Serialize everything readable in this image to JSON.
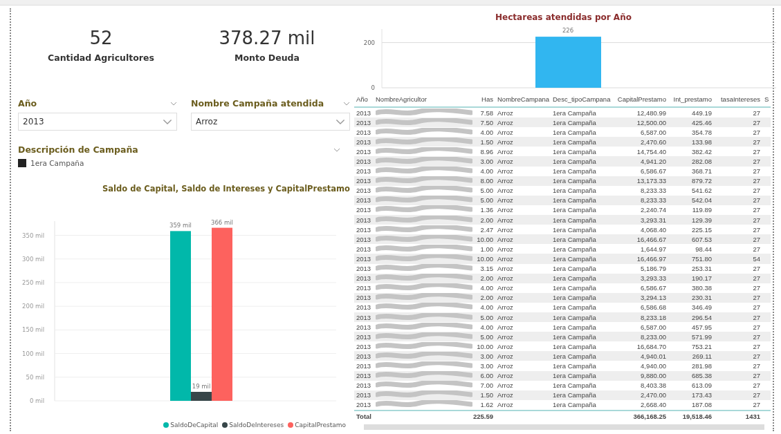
{
  "kpis": [
    {
      "value": "52",
      "label": "Cantidad Agricultores"
    },
    {
      "value": "378.27 mil",
      "label": "Monto Deuda"
    }
  ],
  "slicers": [
    {
      "title": "Año",
      "value": "2013"
    },
    {
      "title": "Nombre Campaña atendida",
      "value": "Arroz"
    }
  ],
  "description_slicer": {
    "title": "Descripción de Campaña",
    "items": [
      {
        "label": "1era Campaña",
        "checked": true
      }
    ]
  },
  "capital_chart": {
    "chart_data": {
      "type": "bar",
      "title": "Saldo de Capital, Saldo de Intereses y CapitalPrestamo",
      "grid": true,
      "series": [
        {
          "name": "SaldoDeCapital",
          "color": "#01b8aa",
          "values": [
            359
          ]
        },
        {
          "name": "SaldoDeIntereses",
          "color": "#374649",
          "values": [
            19
          ]
        },
        {
          "name": "CapitalPrestamo",
          "color": "#fd625e",
          "values": [
            366
          ]
        }
      ],
      "ylim": [
        0,
        380
      ],
      "yticks": [
        {
          "value": 0,
          "label": "0 mil"
        },
        {
          "value": 50,
          "label": "50 mil"
        },
        {
          "value": 100,
          "label": "100 mil"
        },
        {
          "value": 150,
          "label": "150 mil"
        },
        {
          "value": 200,
          "label": "200 mil"
        },
        {
          "value": 250,
          "label": "250 mil"
        },
        {
          "value": 300,
          "label": "300 mil"
        },
        {
          "value": 350,
          "label": "350 mil"
        }
      ],
      "value_labels": [
        "359 mil",
        "19 mil",
        "366 mil"
      ]
    }
  },
  "hectares_chart": {
    "chart_data": {
      "type": "bar",
      "title": "Hectareas atendidas por Año",
      "grid": true,
      "series": [
        {
          "color": "#31b6f0",
          "values": [
            226
          ]
        }
      ],
      "ylim": [
        0,
        260
      ],
      "yticks": [
        0,
        200
      ],
      "value_labels": [
        "226"
      ]
    }
  },
  "table": {
    "columns": [
      "Año",
      "NombreAgricultor",
      "Has",
      "NombreCampana",
      "Desc_tipoCampana",
      "CapitalPrestamo",
      "Int_prestamo",
      "tasaIntereses",
      "S"
    ],
    "rows": [
      {
        "cells": [
          "2013",
          "",
          "7.58",
          "Arroz",
          "1era Campaña",
          "12,480.99",
          "449.19",
          "27"
        ]
      },
      {
        "cells": [
          "2013",
          "",
          "7.50",
          "Arroz",
          "1era Campaña",
          "12,500.00",
          "425.46",
          "27"
        ]
      },
      {
        "cells": [
          "2013",
          "",
          "4.00",
          "Arroz",
          "1era Campaña",
          "6,587.00",
          "354.78",
          "27"
        ]
      },
      {
        "cells": [
          "2013",
          "",
          "1.50",
          "Arroz",
          "1era Campaña",
          "2,470.60",
          "133.98",
          "27"
        ]
      },
      {
        "cells": [
          "2013",
          "",
          "8.96",
          "Arroz",
          "1era Campaña",
          "14,754.40",
          "382.42",
          "27"
        ]
      },
      {
        "cells": [
          "2013",
          "",
          "3.00",
          "Arroz",
          "1era Campaña",
          "4,941.20",
          "282.08",
          "27"
        ]
      },
      {
        "cells": [
          "2013",
          "",
          "4.00",
          "Arroz",
          "1era Campaña",
          "6,586.67",
          "368.71",
          "27"
        ]
      },
      {
        "cells": [
          "2013",
          "",
          "8.00",
          "Arroz",
          "1era Campaña",
          "13,173.33",
          "879.72",
          "27"
        ]
      },
      {
        "cells": [
          "2013",
          "",
          "5.00",
          "Arroz",
          "1era Campaña",
          "8,233.33",
          "541.62",
          "27"
        ]
      },
      {
        "cells": [
          "2013",
          "",
          "5.00",
          "Arroz",
          "1era Campaña",
          "8,233.33",
          "542.04",
          "27"
        ]
      },
      {
        "cells": [
          "2013",
          "",
          "1.36",
          "Arroz",
          "1era Campaña",
          "2,240.74",
          "119.89",
          "27"
        ]
      },
      {
        "cells": [
          "2013",
          "",
          "2.00",
          "Arroz",
          "1era Campaña",
          "3,293.31",
          "129.39",
          "27"
        ]
      },
      {
        "cells": [
          "2013",
          "",
          "2.47",
          "Arroz",
          "1era Campaña",
          "4,068.40",
          "225.15",
          "27"
        ]
      },
      {
        "cells": [
          "2013",
          "",
          "10.00",
          "Arroz",
          "1era Campaña",
          "16,466.67",
          "607.53",
          "27"
        ]
      },
      {
        "cells": [
          "2013",
          "",
          "1.00",
          "Arroz",
          "1era Campaña",
          "1,644.97",
          "98.44",
          "27"
        ]
      },
      {
        "cells": [
          "2013",
          "",
          "10.00",
          "Arroz",
          "1era Campaña",
          "16,466.97",
          "751.80",
          "54"
        ]
      },
      {
        "cells": [
          "2013",
          "",
          "3.15",
          "Arroz",
          "1era Campaña",
          "5,186.79",
          "253.31",
          "27"
        ]
      },
      {
        "cells": [
          "2013",
          "",
          "2.00",
          "Arroz",
          "1era Campaña",
          "3,293.33",
          "190.17",
          "27"
        ]
      },
      {
        "cells": [
          "2013",
          "",
          "4.00",
          "Arroz",
          "1era Campaña",
          "6,586.67",
          "380.38",
          "27"
        ]
      },
      {
        "cells": [
          "2013",
          "",
          "2.00",
          "Arroz",
          "1era Campaña",
          "3,294.13",
          "230.31",
          "27"
        ]
      },
      {
        "cells": [
          "2013",
          "",
          "4.00",
          "Arroz",
          "1era Campaña",
          "6,586.68",
          "346.49",
          "27"
        ]
      },
      {
        "cells": [
          "2013",
          "",
          "5.00",
          "Arroz",
          "1era Campaña",
          "8,233.18",
          "296.54",
          "27"
        ]
      },
      {
        "cells": [
          "2013",
          "",
          "4.00",
          "Arroz",
          "1era Campaña",
          "6,587.00",
          "457.95",
          "27"
        ]
      },
      {
        "cells": [
          "2013",
          "",
          "5.00",
          "Arroz",
          "1era Campaña",
          "8,233.00",
          "571.99",
          "27"
        ]
      },
      {
        "cells": [
          "2013",
          "",
          "10.00",
          "Arroz",
          "1era Campaña",
          "16,684.70",
          "753.21",
          "27"
        ]
      },
      {
        "cells": [
          "2013",
          "",
          "3.00",
          "Arroz",
          "1era Campaña",
          "4,940.01",
          "269.11",
          "27"
        ]
      },
      {
        "cells": [
          "2013",
          "",
          "3.00",
          "Arroz",
          "1era Campaña",
          "4,940.00",
          "281.98",
          "27"
        ]
      },
      {
        "cells": [
          "2013",
          "",
          "6.00",
          "Arroz",
          "1era Campaña",
          "9,880.00",
          "685.38",
          "27"
        ]
      },
      {
        "cells": [
          "2013",
          "",
          "7.00",
          "Arroz",
          "1era Campaña",
          "8,403.38",
          "613.09",
          "27"
        ]
      },
      {
        "cells": [
          "2013",
          "",
          "1.50",
          "Arroz",
          "1era Campaña",
          "2,470.00",
          "173.43",
          "27"
        ]
      },
      {
        "cells": [
          "2013",
          "",
          "1.62",
          "Arroz",
          "1era Campaña",
          "2,668.40",
          "187.08",
          "27"
        ]
      }
    ],
    "total": {
      "label": "Total",
      "cells": [
        "225.59",
        "",
        "",
        "366,168.25",
        "19,518.46",
        "1431"
      ]
    }
  }
}
